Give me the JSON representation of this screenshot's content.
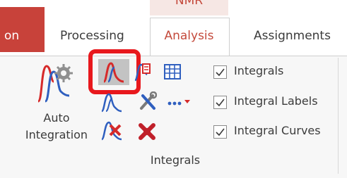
{
  "ribbon": {
    "context_title": "NMR",
    "tabs": [
      {
        "label": "on"
      },
      {
        "label": "Processing"
      },
      {
        "label": "Analysis"
      },
      {
        "label": "Assignments"
      }
    ],
    "active_tab": "Analysis",
    "group": {
      "name": "Integrals",
      "auto_integration": {
        "line1": "Auto",
        "line2": "Integration"
      },
      "options": [
        {
          "label": "Integrals",
          "checked": true
        },
        {
          "label": "Integral Labels",
          "checked": true
        },
        {
          "label": "Integral Curves",
          "checked": true
        }
      ]
    }
  },
  "colors": {
    "accent": "#c44a3c",
    "highlight": "#e8181d",
    "integral_blue": "#2f5fbf",
    "integral_red": "#d62a2a"
  }
}
